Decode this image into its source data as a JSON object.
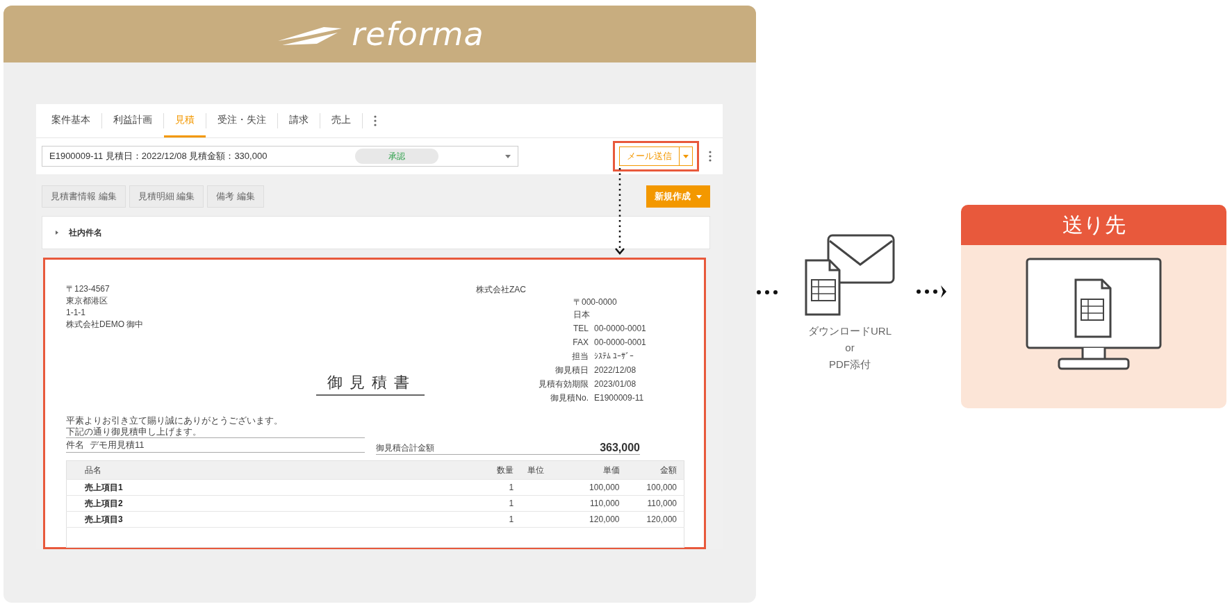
{
  "header": {
    "logo": "reforma"
  },
  "tabs": [
    {
      "label": "案件基本",
      "selected": false
    },
    {
      "label": "利益計画",
      "selected": false
    },
    {
      "label": "見積",
      "selected": true
    },
    {
      "label": "受注・失注",
      "selected": false
    },
    {
      "label": "請求",
      "selected": false
    },
    {
      "label": "売上",
      "selected": false
    }
  ],
  "estimate_select": {
    "value": "E1900009-11 見積日：2022/12/08 見積金額：330,000",
    "status": "承認"
  },
  "mail_button": {
    "label": "メール送信",
    "highlighted": true
  },
  "edit_buttons": [
    "見積書情報 編集",
    "見積明細 編集",
    "備考 編集"
  ],
  "new_button": {
    "label": "新規作成"
  },
  "section": {
    "label": "社内件名",
    "expanded": false
  },
  "document": {
    "recipient": [
      "〒123-4567",
      "東京都港区",
      "1-1-1",
      "株式会社DEMO 御中"
    ],
    "issuer": [
      "株式会社ZAC",
      "〒000-0000",
      "日本"
    ],
    "details": [
      {
        "label": "TEL",
        "value": "00-0000-0001"
      },
      {
        "label": "FAX",
        "value": "00-0000-0001"
      },
      {
        "label": "担当",
        "value": "ｼｽﾃﾑ ﾕｰｻﾞｰ"
      },
      {
        "label": "御見積日",
        "value": "2022/12/08"
      },
      {
        "label": "見積有効期限",
        "value": "2023/01/08"
      },
      {
        "label": "御見積No.",
        "value": "E1900009-11"
      }
    ],
    "title": "御見積書",
    "greeting": [
      "平素よりお引き立て賜り誠にありがとうございます。",
      "下記の通り御見積申し上げます。"
    ],
    "subject": {
      "label": "件名",
      "value": "デモ用見積11"
    },
    "total": {
      "label": "御見積合計金額",
      "value": "363,000"
    },
    "table": {
      "columns": [
        "品名",
        "数量",
        "単位",
        "単価",
        "金額"
      ],
      "rows": [
        {
          "name": "売上項目1",
          "quantity": "1",
          "unit_price": "100,000",
          "amount": "100,000"
        },
        {
          "name": "売上項目2",
          "quantity": "1",
          "unit_price": "110,000",
          "amount": "110,000"
        },
        {
          "name": "売上項目3",
          "quantity": "1",
          "unit_price": "120,000",
          "amount": "120,000"
        }
      ]
    }
  },
  "delivery": {
    "methods": [
      "ダウンロードURL",
      "or",
      "PDF添付"
    ],
    "destination": {
      "title": "送り先"
    }
  }
}
